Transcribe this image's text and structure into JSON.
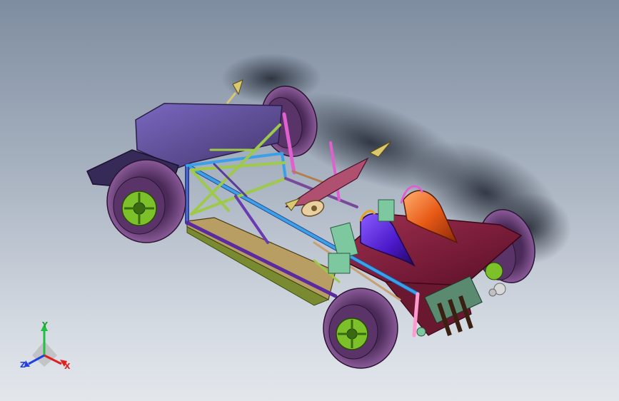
{
  "colors": {
    "background_top": "#7e8da0",
    "background_bottom": "#e3e7ec",
    "body_panel": "#5d4e9c",
    "frame_blue": "#3aa0e8",
    "frame_green": "#9ec94a",
    "frame_magenta": "#c040d8",
    "floor_panel": "#b4a06a",
    "rear_deck": "#7a1a3a",
    "headrest_blue": "#5a2ad8",
    "headrest_orange": "#e8601a",
    "tire": "#6b3d7a",
    "rim": "#7cc02a",
    "axis_x": "#e02020",
    "axis_y": "#20c040",
    "axis_z": "#2040e0"
  },
  "model": {
    "name": "tube-frame-race-car-chassis",
    "icons": [
      "wheel-front-left",
      "wheel-front-right",
      "wheel-rear-left",
      "wheel-rear-right",
      "nose-body-panel",
      "rear-deck",
      "headrest-left",
      "headrest-right"
    ]
  },
  "triad": {
    "x_label": "X",
    "y_label": "Y",
    "z_label": "Z"
  }
}
